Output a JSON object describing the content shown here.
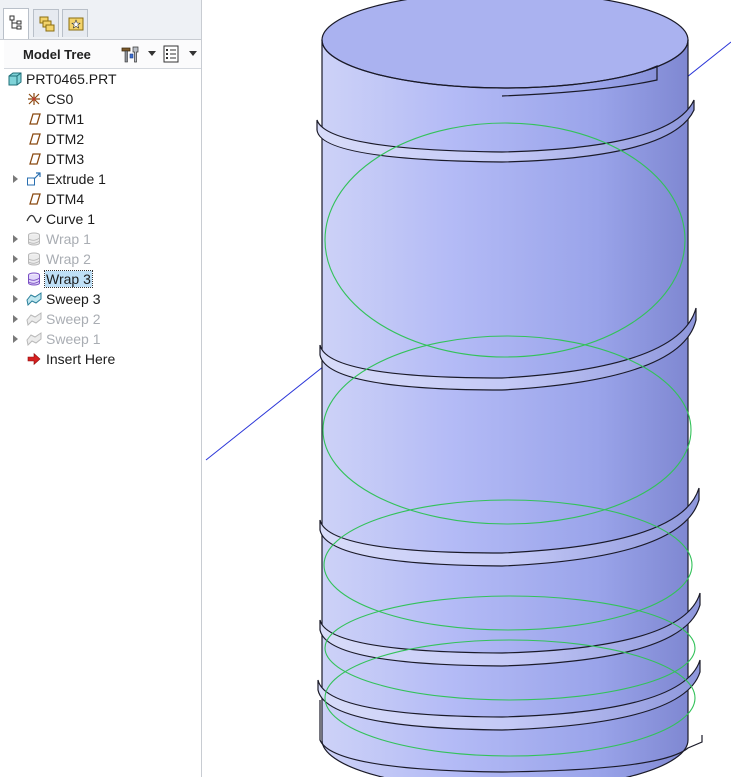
{
  "tabs": [
    {
      "icon": "model-tree-icon",
      "active": true
    },
    {
      "icon": "folder-browser-icon",
      "active": false
    },
    {
      "icon": "favorites-icon",
      "active": false
    }
  ],
  "tree_header": {
    "title": "Model Tree",
    "settings_icon": "tree-settings-icon",
    "columns_icon": "tree-columns-icon"
  },
  "tree": {
    "root": {
      "label": "PRT0465.PRT",
      "icon": "part-icon"
    },
    "items": [
      {
        "label": "CS0",
        "icon": "csys-icon",
        "expandable": false,
        "dim": false,
        "selected": false
      },
      {
        "label": "DTM1",
        "icon": "datum-plane-icon",
        "expandable": false,
        "dim": false,
        "selected": false
      },
      {
        "label": "DTM2",
        "icon": "datum-plane-icon",
        "expandable": false,
        "dim": false,
        "selected": false
      },
      {
        "label": "DTM3",
        "icon": "datum-plane-icon",
        "expandable": false,
        "dim": false,
        "selected": false
      },
      {
        "label": "Extrude 1",
        "icon": "extrude-icon",
        "expandable": true,
        "dim": false,
        "selected": false
      },
      {
        "label": "DTM4",
        "icon": "datum-plane-icon",
        "expandable": false,
        "dim": false,
        "selected": false
      },
      {
        "label": "Curve 1",
        "icon": "curve-icon",
        "expandable": false,
        "dim": false,
        "selected": false
      },
      {
        "label": "Wrap 1",
        "icon": "wrap-icon",
        "expandable": true,
        "dim": true,
        "selected": false
      },
      {
        "label": "Wrap 2",
        "icon": "wrap-icon",
        "expandable": true,
        "dim": true,
        "selected": false
      },
      {
        "label": "Wrap 3",
        "icon": "wrap-icon",
        "expandable": true,
        "dim": false,
        "selected": true
      },
      {
        "label": "Sweep 3",
        "icon": "sweep-icon",
        "expandable": true,
        "dim": false,
        "selected": false
      },
      {
        "label": "Sweep 2",
        "icon": "sweep-icon",
        "expandable": true,
        "dim": true,
        "selected": false
      },
      {
        "label": "Sweep 1",
        "icon": "sweep-icon",
        "expandable": true,
        "dim": true,
        "selected": false
      },
      {
        "label": "Insert Here",
        "icon": "insert-here-arrow-icon",
        "expandable": false,
        "dim": false,
        "selected": false
      }
    ]
  },
  "viewport": {
    "model": "cylinder-with-helical-sweep",
    "colors": {
      "body": "#a8b0f2",
      "body_dark": "#6e78c8",
      "curve": "#33c25a",
      "axis": "#2a35d8",
      "edge": "#1a1a28"
    }
  }
}
